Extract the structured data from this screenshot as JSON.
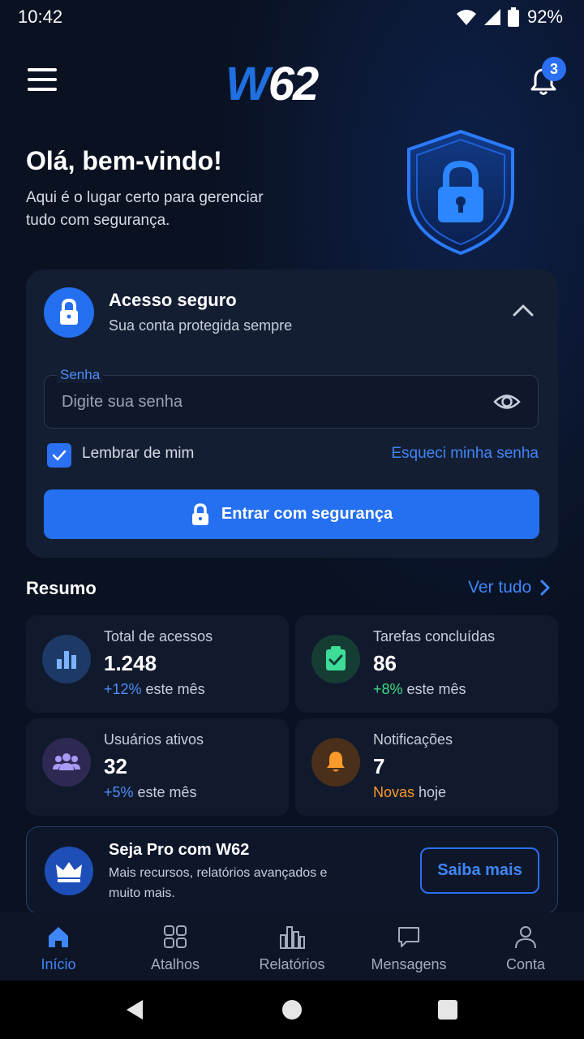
{
  "status_bar": {
    "time": "10:42",
    "battery": "92%"
  },
  "header": {
    "logo_w": "W",
    "logo_num": "62",
    "notification_count": "3"
  },
  "hero": {
    "title": "Olá, bem-vindo!",
    "subtitle": "Aqui é o lugar certo para gerenciar tudo com segurança."
  },
  "login_card": {
    "title": "Acesso seguro",
    "subtitle": "Sua conta protegida sempre",
    "field_label": "Senha",
    "field_placeholder": "Digite sua senha",
    "field_value": "",
    "remember_label": "Lembrar de mim",
    "remember_checked": true,
    "forgot_label": "Esqueci minha senha",
    "submit_label": "Entrar com segurança"
  },
  "summary": {
    "title": "Resumo",
    "see_all": "Ver tudo",
    "stats": [
      {
        "label": "Total de acessos",
        "value": "1.248",
        "delta": "+12%",
        "suffix": " este mês",
        "icon": "bar-chart-icon",
        "icon_bg": "#1d3a66",
        "icon_color": "#7db2ff",
        "delta_color": "#4d8ef7"
      },
      {
        "label": "Tarefas concluídas",
        "value": "86",
        "delta": "+8%",
        "suffix": " este mês",
        "icon": "clipboard-check-icon",
        "icon_bg": "#153d34",
        "icon_color": "#3ddc97",
        "delta_color": "#3ddc84"
      },
      {
        "label": "Usuários ativos",
        "value": "32",
        "delta": "+5%",
        "suffix": " este mês",
        "icon": "users-icon",
        "icon_bg": "#2e2952",
        "icon_color": "#a99af5",
        "delta_color": "#4d8ef7"
      },
      {
        "label": "Notificações",
        "value": "7",
        "delta": "Novas",
        "suffix": " hoje",
        "icon": "bell-icon",
        "icon_bg": "#4a2f1a",
        "icon_color": "#f99a2b",
        "delta_color": "#f99a2b"
      }
    ]
  },
  "pro_banner": {
    "title": "Seja Pro com W62",
    "description": "Mais recursos, relatórios avançados e muito mais.",
    "button": "Saiba mais"
  },
  "bottom_nav": {
    "items": [
      {
        "label": "Início",
        "icon": "home-icon",
        "active": true
      },
      {
        "label": "Atalhos",
        "icon": "grid-icon",
        "active": false
      },
      {
        "label": "Relatórios",
        "icon": "bars-icon",
        "active": false
      },
      {
        "label": "Mensagens",
        "icon": "chat-icon",
        "active": false
      },
      {
        "label": "Conta",
        "icon": "user-icon",
        "active": false
      }
    ]
  },
  "colors": {
    "accent": "#2470f0",
    "background": "#0a1120",
    "card": "#141e33"
  }
}
